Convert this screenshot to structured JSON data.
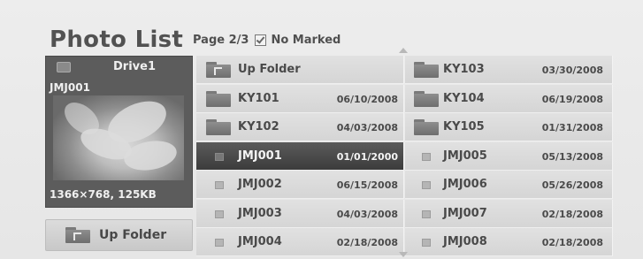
{
  "header": {
    "title": "Photo List",
    "page": "Page 2/3",
    "marked": "No Marked"
  },
  "preview": {
    "drive": "Drive1",
    "name": "JMJ001",
    "info": "1366×768, 125KB"
  },
  "up_folder_button": {
    "label": "Up Folder"
  },
  "grid": {
    "col0": [
      {
        "type": "upfolder",
        "name": "Up Folder",
        "date": ""
      },
      {
        "type": "folder",
        "name": "KY101",
        "date": "06/10/2008"
      },
      {
        "type": "folder",
        "name": "KY102",
        "date": "04/03/2008"
      },
      {
        "type": "file",
        "name": "JMJ001",
        "date": "01/01/2000",
        "selected": true
      },
      {
        "type": "file",
        "name": "JMJ002",
        "date": "06/15/2008"
      },
      {
        "type": "file",
        "name": "JMJ003",
        "date": "04/03/2008"
      },
      {
        "type": "file",
        "name": "JMJ004",
        "date": "02/18/2008"
      }
    ],
    "col1": [
      {
        "type": "folder",
        "name": "KY103",
        "date": "03/30/2008"
      },
      {
        "type": "folder",
        "name": "KY104",
        "date": "06/19/2008"
      },
      {
        "type": "folder",
        "name": "KY105",
        "date": "01/31/2008"
      },
      {
        "type": "file",
        "name": "JMJ005",
        "date": "05/13/2008"
      },
      {
        "type": "file",
        "name": "JMJ006",
        "date": "05/26/2008"
      },
      {
        "type": "file",
        "name": "JMJ007",
        "date": "02/18/2008"
      },
      {
        "type": "file",
        "name": "JMJ008",
        "date": "02/18/2008"
      }
    ]
  },
  "colors": {
    "background": "#e9e9e9",
    "cell": "#dadada",
    "selected": "#474747",
    "preview_panel": "#5c5c5c"
  },
  "icons": {
    "folder": "folder-icon",
    "up_folder": "up-folder-icon",
    "file": "photo-file-icon",
    "drive": "usb-drive-icon",
    "checkbox": "checkbox-checked-icon",
    "scroll_up": "scroll-up-arrow-icon",
    "scroll_down": "scroll-down-arrow-icon"
  }
}
